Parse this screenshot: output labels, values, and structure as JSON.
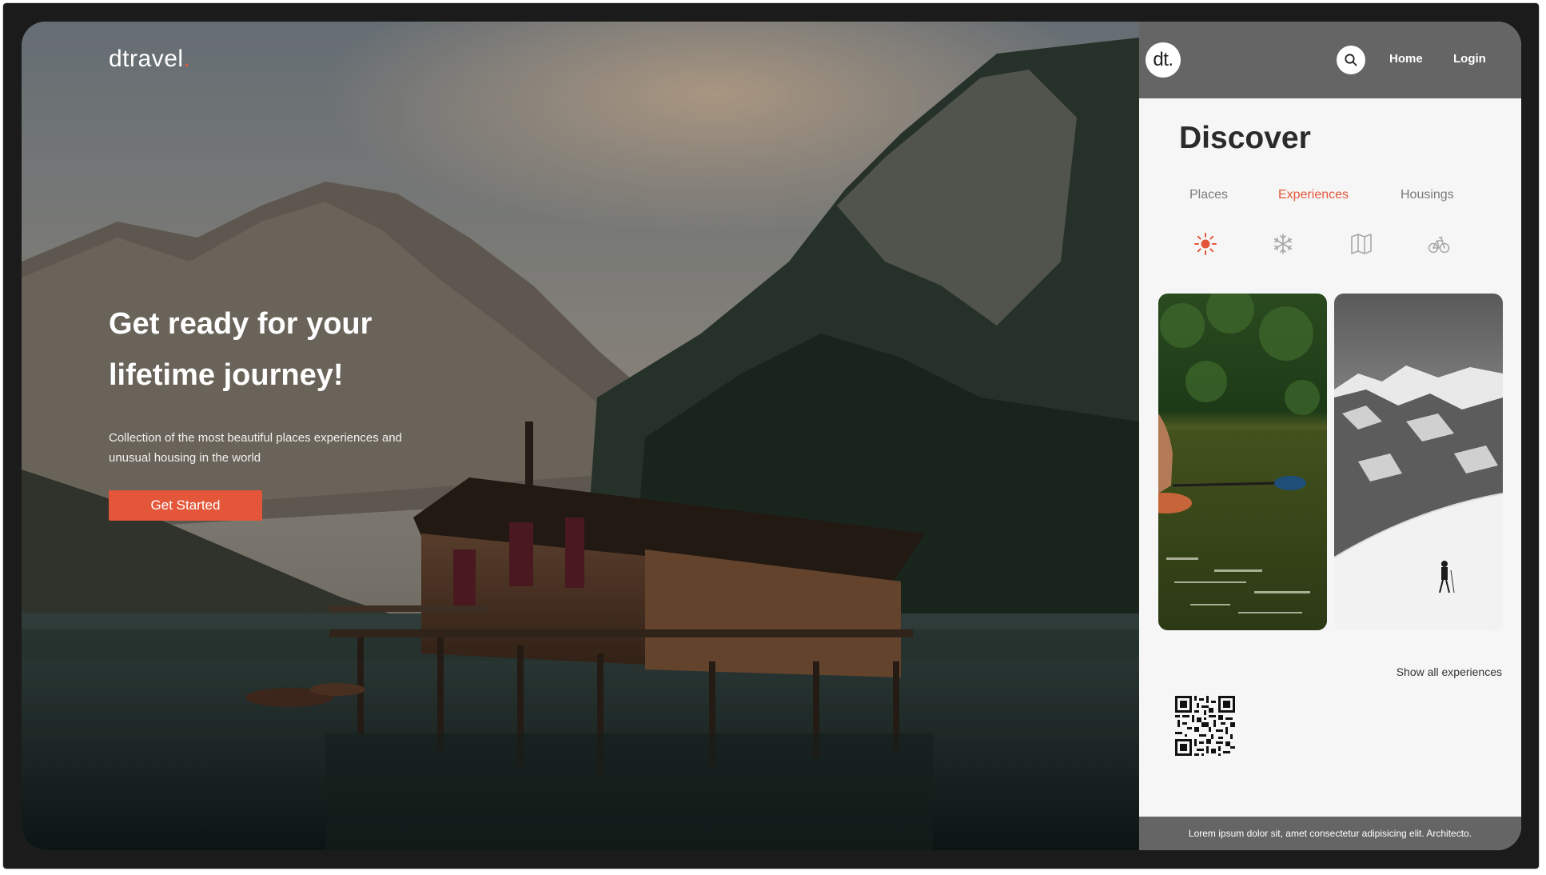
{
  "hero": {
    "brand": "dtravel",
    "brand_dot": ".",
    "headline": "Get ready for your lifetime journey!",
    "subline": "Collection of the most beautiful places experiences and unusual housing in the world",
    "cta_label": "Get Started"
  },
  "topbar": {
    "logo": "dt.",
    "search_icon": "search-icon",
    "nav": [
      "Home",
      "Login"
    ]
  },
  "discover": {
    "title": "Discover",
    "tabs": [
      "Places",
      "Experiences",
      "Housings"
    ],
    "active_tab": "Experiences",
    "category_icons": [
      "sun-icon",
      "snowflake-icon",
      "map-icon",
      "bicycle-icon"
    ],
    "active_category": "sun-icon",
    "cards": [
      "kayak",
      "ski-touring"
    ],
    "show_all_label": "Show all experiences"
  },
  "footer": {
    "text": "Lorem ipsum dolor sit, amet consectetur adipisicing elit. Architecto."
  },
  "colors": {
    "accent": "#e4563a",
    "topbar": "#656565",
    "panel_bg": "#f6f6f6",
    "frame": "#1b1b1b"
  }
}
